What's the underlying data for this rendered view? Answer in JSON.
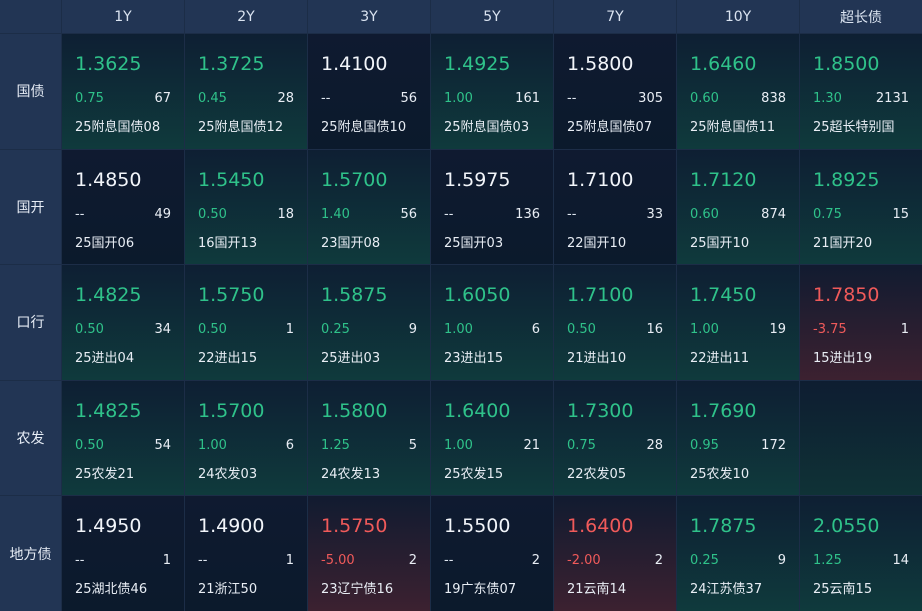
{
  "columns": [
    "1Y",
    "2Y",
    "3Y",
    "5Y",
    "7Y",
    "10Y",
    "超长债"
  ],
  "rows": [
    {
      "label": "国债",
      "cells": [
        {
          "rate": "1.3625",
          "chg": "0.75",
          "vol": "67",
          "name": "25附息国债08",
          "trend": "up"
        },
        {
          "rate": "1.3725",
          "chg": "0.45",
          "vol": "28",
          "name": "25附息国债12",
          "trend": "up"
        },
        {
          "rate": "1.4100",
          "chg": "--",
          "vol": "56",
          "name": "25附息国债10",
          "trend": "flat"
        },
        {
          "rate": "1.4925",
          "chg": "1.00",
          "vol": "161",
          "name": "25附息国债03",
          "trend": "up"
        },
        {
          "rate": "1.5800",
          "chg": "--",
          "vol": "305",
          "name": "25附息国债07",
          "trend": "flat"
        },
        {
          "rate": "1.6460",
          "chg": "0.60",
          "vol": "838",
          "name": "25附息国债11",
          "trend": "up"
        },
        {
          "rate": "1.8500",
          "chg": "1.30",
          "vol": "2131",
          "name": "25超长特别国",
          "trend": "up"
        }
      ]
    },
    {
      "label": "国开",
      "cells": [
        {
          "rate": "1.4850",
          "chg": "--",
          "vol": "49",
          "name": "25国开06",
          "trend": "flat"
        },
        {
          "rate": "1.5450",
          "chg": "0.50",
          "vol": "18",
          "name": "16国开13",
          "trend": "up"
        },
        {
          "rate": "1.5700",
          "chg": "1.40",
          "vol": "56",
          "name": "23国开08",
          "trend": "up"
        },
        {
          "rate": "1.5975",
          "chg": "--",
          "vol": "136",
          "name": "25国开03",
          "trend": "flat"
        },
        {
          "rate": "1.7100",
          "chg": "--",
          "vol": "33",
          "name": "22国开10",
          "trend": "flat"
        },
        {
          "rate": "1.7120",
          "chg": "0.60",
          "vol": "874",
          "name": "25国开10",
          "trend": "up"
        },
        {
          "rate": "1.8925",
          "chg": "0.75",
          "vol": "15",
          "name": "21国开20",
          "trend": "up"
        }
      ]
    },
    {
      "label": "口行",
      "cells": [
        {
          "rate": "1.4825",
          "chg": "0.50",
          "vol": "34",
          "name": "25进出04",
          "trend": "up"
        },
        {
          "rate": "1.5750",
          "chg": "0.50",
          "vol": "1",
          "name": "22进出15",
          "trend": "up"
        },
        {
          "rate": "1.5875",
          "chg": "0.25",
          "vol": "9",
          "name": "25进出03",
          "trend": "up"
        },
        {
          "rate": "1.6050",
          "chg": "1.00",
          "vol": "6",
          "name": "23进出15",
          "trend": "up"
        },
        {
          "rate": "1.7100",
          "chg": "0.50",
          "vol": "16",
          "name": "21进出10",
          "trend": "up"
        },
        {
          "rate": "1.7450",
          "chg": "1.00",
          "vol": "19",
          "name": "22进出11",
          "trend": "up"
        },
        {
          "rate": "1.7850",
          "chg": "-3.75",
          "vol": "1",
          "name": "15进出19",
          "trend": "down"
        }
      ]
    },
    {
      "label": "农发",
      "cells": [
        {
          "rate": "1.4825",
          "chg": "0.50",
          "vol": "54",
          "name": "25农发21",
          "trend": "up"
        },
        {
          "rate": "1.5700",
          "chg": "1.00",
          "vol": "6",
          "name": "24农发03",
          "trend": "up"
        },
        {
          "rate": "1.5800",
          "chg": "1.25",
          "vol": "5",
          "name": "24农发13",
          "trend": "up"
        },
        {
          "rate": "1.6400",
          "chg": "1.00",
          "vol": "21",
          "name": "25农发15",
          "trend": "up"
        },
        {
          "rate": "1.7300",
          "chg": "0.75",
          "vol": "28",
          "name": "22农发05",
          "trend": "up"
        },
        {
          "rate": "1.7690",
          "chg": "0.95",
          "vol": "172",
          "name": "25农发10",
          "trend": "up"
        },
        {
          "rate": "",
          "chg": "",
          "vol": "",
          "name": "",
          "trend": "empty"
        }
      ]
    },
    {
      "label": "地方债",
      "cells": [
        {
          "rate": "1.4950",
          "chg": "--",
          "vol": "1",
          "name": "25湖北债46",
          "trend": "flat"
        },
        {
          "rate": "1.4900",
          "chg": "--",
          "vol": "1",
          "name": "21浙江50",
          "trend": "flat"
        },
        {
          "rate": "1.5750",
          "chg": "-5.00",
          "vol": "2",
          "name": "23辽宁债16",
          "trend": "down"
        },
        {
          "rate": "1.5500",
          "chg": "--",
          "vol": "2",
          "name": "19广东债07",
          "trend": "flat"
        },
        {
          "rate": "1.6400",
          "chg": "-2.00",
          "vol": "2",
          "name": "21云南14",
          "trend": "down"
        },
        {
          "rate": "1.7875",
          "chg": "0.25",
          "vol": "9",
          "name": "24江苏债37",
          "trend": "up"
        },
        {
          "rate": "2.0550",
          "chg": "1.25",
          "vol": "14",
          "name": "25云南15",
          "trend": "up"
        }
      ]
    }
  ],
  "colors": {
    "up": "#2fc28a",
    "down": "#f05a5a",
    "header_bg": "#223554",
    "grid_bg": "#1c2d47"
  }
}
